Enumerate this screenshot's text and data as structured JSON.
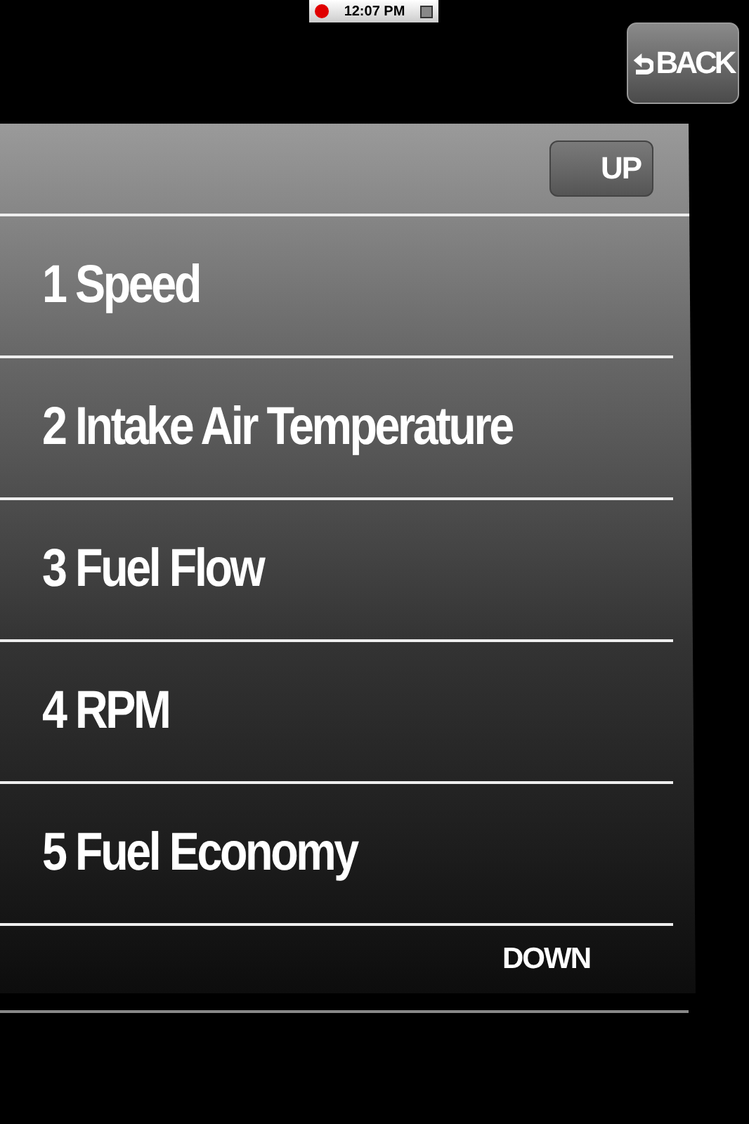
{
  "status_bar": {
    "time": "12:07 PM"
  },
  "back_button": {
    "label": "BACK"
  },
  "up_button": {
    "label": "UP"
  },
  "items": [
    {
      "label": "1 Speed"
    },
    {
      "label": "2 Intake Air Temperature"
    },
    {
      "label": "3 Fuel Flow"
    },
    {
      "label": "4 RPM"
    },
    {
      "label": "5 Fuel Economy"
    }
  ],
  "down_button": {
    "label": "DOWN"
  }
}
